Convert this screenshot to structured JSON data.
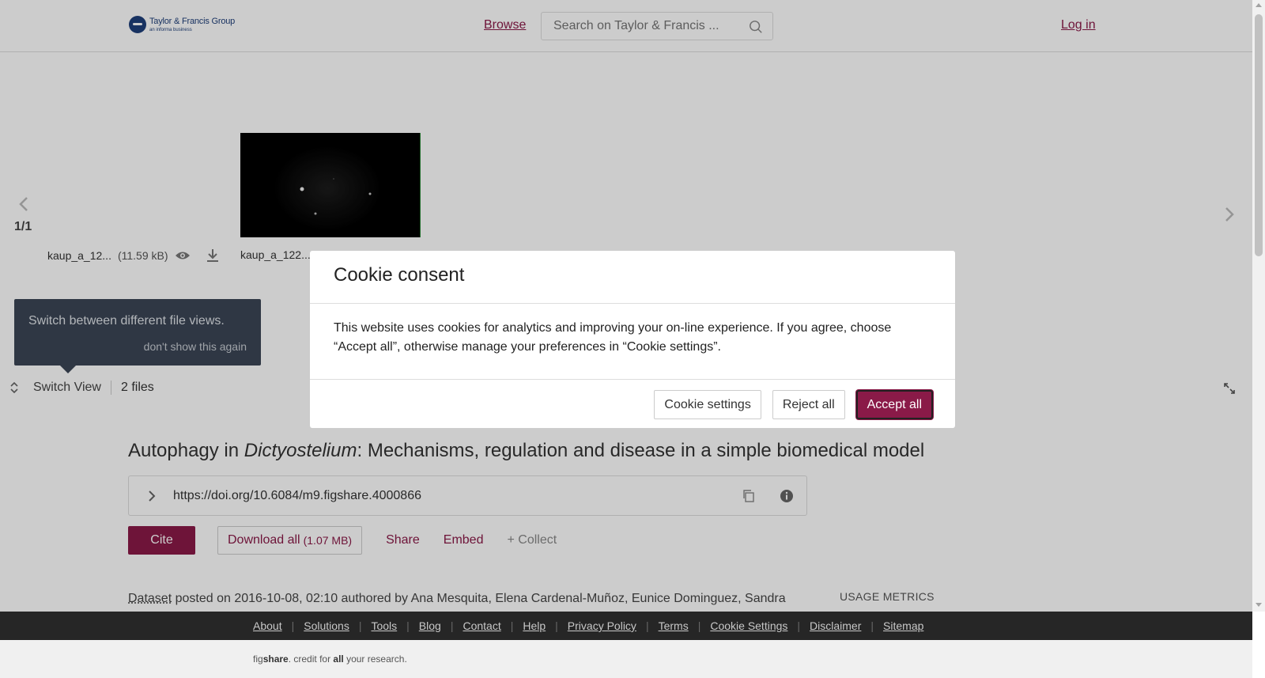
{
  "header": {
    "logo_title": "Taylor & Francis Group",
    "logo_sub": "an informa business",
    "browse_label": "Browse",
    "search_placeholder": "Search on Taylor & Francis ...",
    "login_label": "Log in"
  },
  "viewer": {
    "page_count": "1/1",
    "files": [
      {
        "name": "kaup_a_12...",
        "size": "(11.59 kB)"
      },
      {
        "name": "kaup_a_122..."
      }
    ],
    "tip_text": "Switch between different file views.",
    "tip_dismiss": "don't show this again",
    "switch_view_label": "Switch View",
    "file_count": "2 files"
  },
  "article": {
    "title_pre": "Autophagy in ",
    "title_italic": "Dictyostelium",
    "title_post": ": Mechanisms, regulation and disease in a simple biomedical model",
    "doi": "https://doi.org/10.6084/m9.figshare.4000866",
    "cite_label": "Cite",
    "download_label": "Download all",
    "download_size": "(1.07 MB)",
    "share_label": "Share",
    "embed_label": "Embed",
    "collect_label": "+ Collect",
    "meta_type": "Dataset",
    "meta_text": " posted on 2016-10-08, 02:10 authored by Ana Mesquita, Elena Cardenal-Muñoz, Eunice Dominguez, Sandra",
    "usage_label": "USAGE METRICS"
  },
  "footer": {
    "links": [
      "About",
      "Solutions",
      "Tools",
      "Blog",
      "Contact",
      "Help",
      "Privacy Policy",
      "Terms",
      "Cookie Settings",
      "Disclaimer",
      "Sitemap"
    ],
    "tagline_pre": "fig",
    "tagline_bold": "share",
    "tagline_mid": ". credit for ",
    "tagline_bold2": "all",
    "tagline_post": " your research."
  },
  "cookie_modal": {
    "title": "Cookie consent",
    "body": "This website uses cookies for analytics and improving your on-line experience. If you agree, choose “Accept all”, otherwise manage your preferences in “Cookie settings”.",
    "settings_label": "Cookie settings",
    "reject_label": "Reject all",
    "accept_label": "Accept all"
  },
  "colors": {
    "brand": "#8a1a48",
    "overlay": "rgba(0,0,0,0.2)"
  }
}
